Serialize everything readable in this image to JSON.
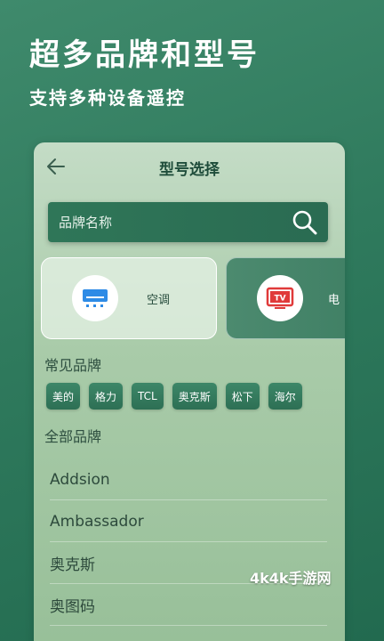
{
  "hero": {
    "title": "超多品牌和型号",
    "subtitle": "支持多种设备遥控"
  },
  "card": {
    "title": "型号选择",
    "search": {
      "placeholder": "品牌名称",
      "value": ""
    },
    "categories": [
      {
        "label": "空调",
        "icon": "air-conditioner-icon"
      },
      {
        "label": "电",
        "icon": "tv-icon",
        "icon_text": "TV"
      }
    ],
    "common_brands_label": "常见品牌",
    "common_brands": [
      "美的",
      "格力",
      "TCL",
      "奥克斯",
      "松下",
      "海尔"
    ],
    "all_brands_label": "全部品牌",
    "all_brands": [
      "Addsion",
      "Ambassador",
      "奥克斯",
      "奥图码"
    ]
  },
  "watermark": "4k4k手游网",
  "colors": {
    "background": "#2f7a5d",
    "card": "#a9cba9",
    "accent": "#2d6f54",
    "tv_red": "#e03a3a",
    "ac_blue": "#2e8be6"
  }
}
